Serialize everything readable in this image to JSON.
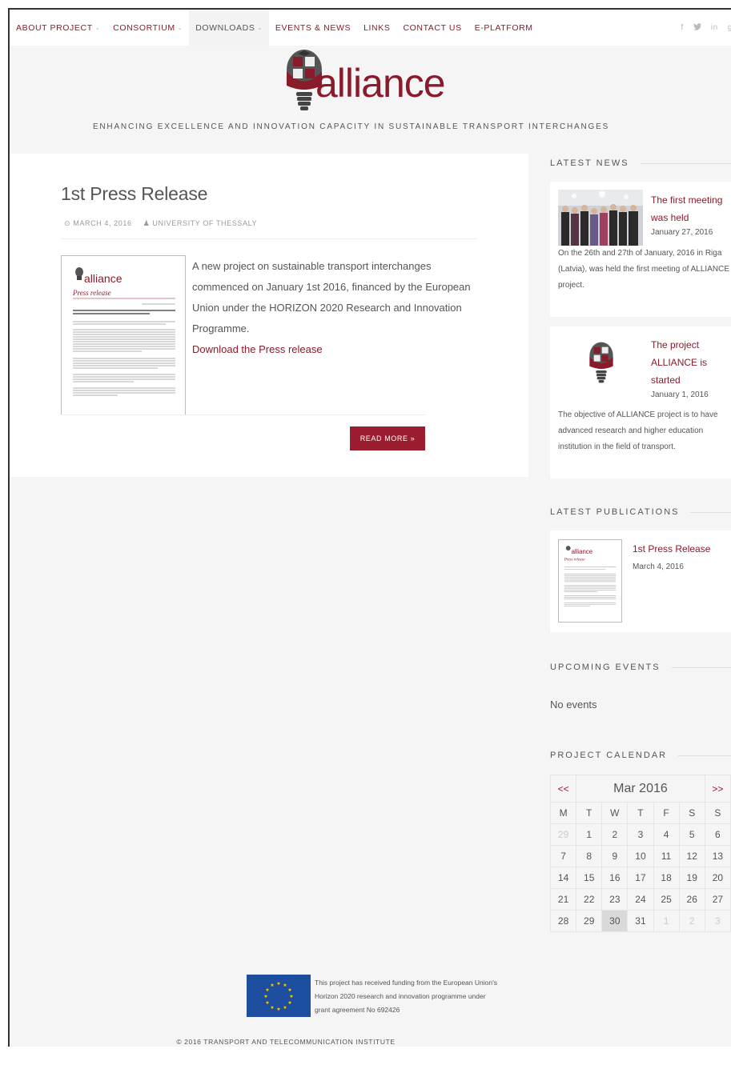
{
  "nav": {
    "items": [
      {
        "label": "ABOUT PROJECT",
        "caret": "⌄"
      },
      {
        "label": "CONSORTIUM",
        "caret": "⌄"
      },
      {
        "label": "DOWNLOADS",
        "caret": "⌄"
      },
      {
        "label": "EVENTS & NEWS",
        "caret": ""
      },
      {
        "label": "LINKS",
        "caret": ""
      },
      {
        "label": "CONTACT US",
        "caret": ""
      },
      {
        "label": "E-PLATFORM",
        "caret": ""
      }
    ],
    "social": [
      "f",
      "t",
      "in",
      "g"
    ]
  },
  "header": {
    "logo_text": "alliance",
    "tagline": "ENHANCING EXCELLENCE AND INNOVATION CAPACITY IN SUSTAINABLE TRANSPORT INTERCHANGES"
  },
  "post": {
    "title": "1st Press Release",
    "date": "MARCH 4, 2016",
    "author": "UNIVERSITY OF THESSALY",
    "body": "A new project on sustainable transport interchanges commenced on January 1st 2016, financed by the European Union under the HORIZON 2020 Research and Innovation Programme.",
    "link": "Download the Press release",
    "read_more": "READ MORE »",
    "thumb_logo": "alliance",
    "thumb_subtitle": "Press release"
  },
  "sidebar": {
    "latest_news": "LATEST NEWS",
    "news": [
      {
        "title": "The first meeting was held",
        "date": "January 27, 2016",
        "body": "On the 26th and 27th of January, 2016 in Riga (Latvia), was held the first meeting of ALLIANCE project."
      },
      {
        "title": "The project ALLIANCE is started",
        "date": "January 1, 2016",
        "body": "The objective of ALLIANCE project is to have advanced research and higher education institution in the field of transport."
      }
    ],
    "latest_publications": "LATEST PUBLICATIONS",
    "publication": {
      "title": "1st Press Release",
      "date": "March 4, 2016",
      "thumb_logo": "alliance",
      "thumb_subtitle": "Press release"
    },
    "upcoming_events": "UPCOMING EVENTS",
    "no_events": "No events",
    "project_calendar": "PROJECT CALENDAR"
  },
  "calendar": {
    "prev": "<<",
    "next": ">>",
    "month": "Mar 2016",
    "days": [
      "M",
      "T",
      "W",
      "T",
      "F",
      "S",
      "S"
    ],
    "weeks": [
      [
        "29",
        "1",
        "2",
        "3",
        "4",
        "5",
        "6"
      ],
      [
        "7",
        "8",
        "9",
        "10",
        "11",
        "12",
        "13"
      ],
      [
        "14",
        "15",
        "16",
        "17",
        "18",
        "19",
        "20"
      ],
      [
        "21",
        "22",
        "23",
        "24",
        "25",
        "26",
        "27"
      ],
      [
        "28",
        "29",
        "30",
        "31",
        "1",
        "2",
        "3"
      ]
    ]
  },
  "footer": {
    "funding": "This project has received funding from the European Union's Horizon 2020 research and innovation programme under grant agreement No 692426",
    "copyright": "© 2016 TRANSPORT AND TELECOMMUNICATION INSTITUTE"
  },
  "colors": {
    "accent": "#8a1b2b",
    "button": "#9b1c2e",
    "eu_blue": "#1d4ea0",
    "eu_star": "#ffd200"
  }
}
